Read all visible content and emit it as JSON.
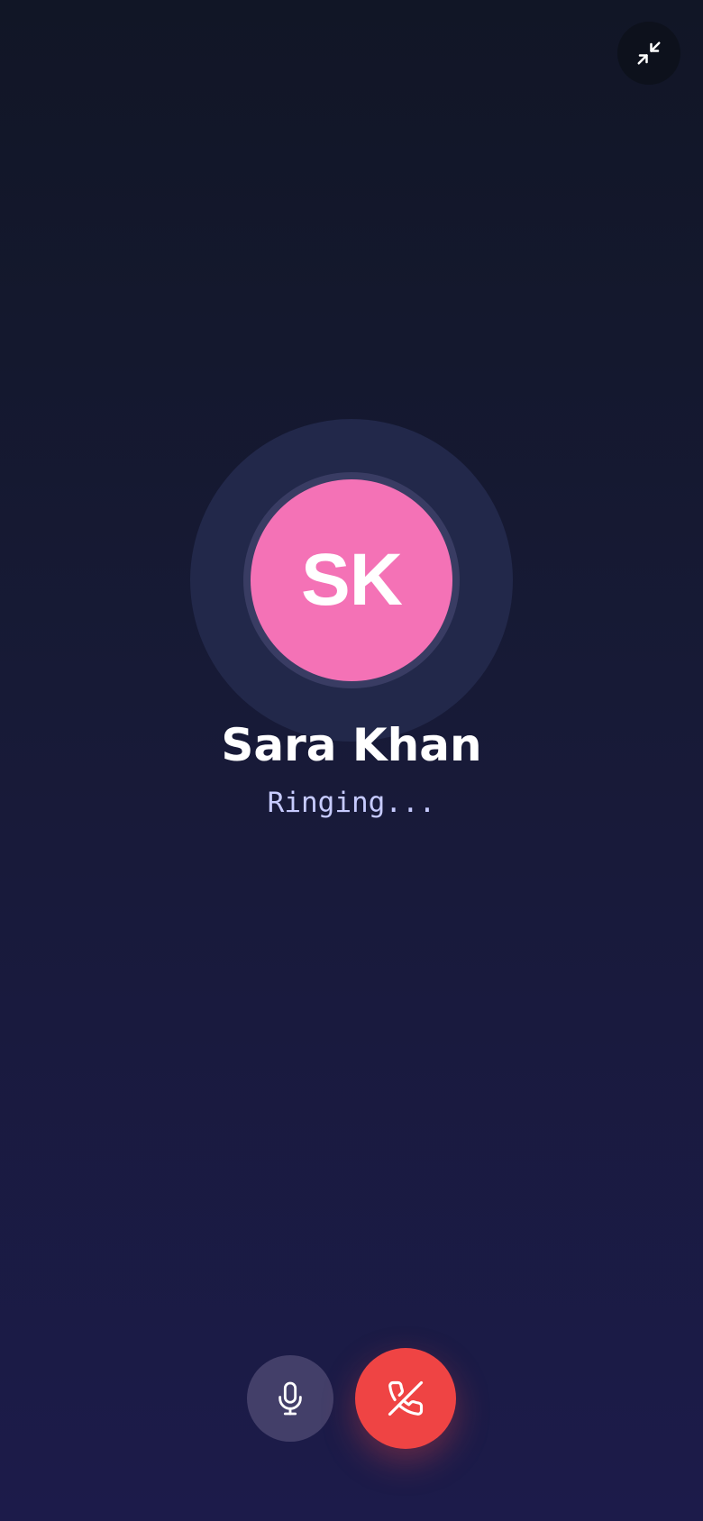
{
  "colors": {
    "avatar_bg": "#f472b6",
    "hangup_bg": "#ef4444",
    "status_text": "#c7cbff"
  },
  "header": {
    "minimize_icon": "minimize-arrows-icon"
  },
  "caller": {
    "initials": "SK",
    "name": "Sara Khan",
    "status": "Ringing..."
  },
  "controls": {
    "mute_icon": "microphone-icon",
    "hangup_icon": "phone-off-icon"
  }
}
